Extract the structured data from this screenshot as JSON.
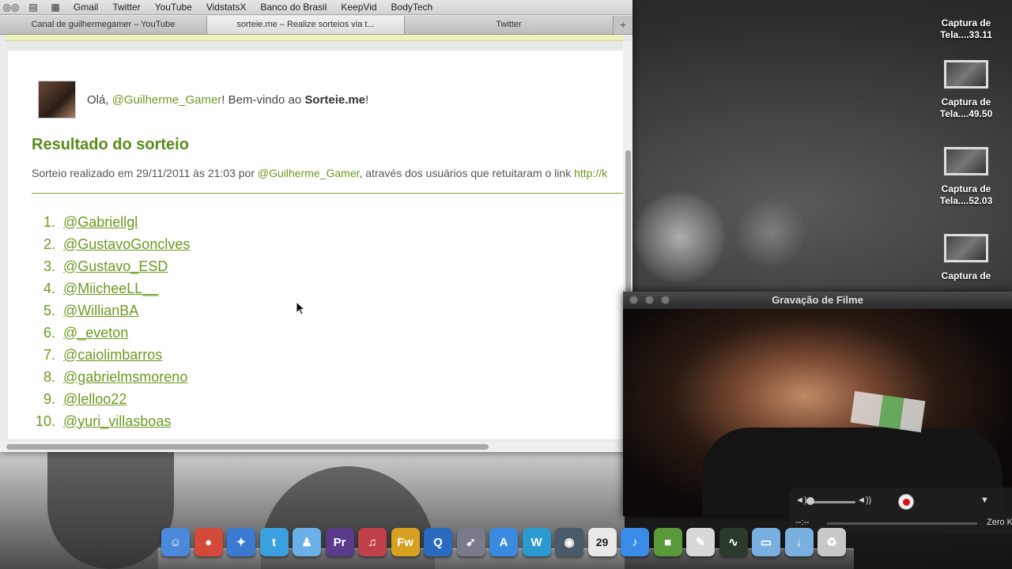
{
  "bookmarks": {
    "items": [
      "Gmail",
      "Twitter",
      "YouTube",
      "VidstatsX",
      "Banco do Brasil",
      "KeepVid",
      "BodyTech"
    ]
  },
  "tabs": [
    {
      "label": "Canal de guilhermegamer – YouTube"
    },
    {
      "label": "sorteie.me – Realize sorteios via t..."
    },
    {
      "label": "Twitter"
    }
  ],
  "tab_add_label": "+",
  "page": {
    "greeting_prefix": "Olá, ",
    "user": "@Guilherme_Gamer",
    "greeting_middle": "! Bem-vindo ao ",
    "site": "Sorteie.me",
    "greeting_suffix": "!",
    "result_title": "Resultado do sorteio",
    "info_prefix": "Sorteio realizado em 29/11/2011 às 21:03 por ",
    "info_user": "@Guilherme_Gamer",
    "info_suffix": ", através dos usuários que retuitaram o link ",
    "info_link": "http://k",
    "winners": [
      {
        "num": "1.",
        "name": "@Gabriellgl"
      },
      {
        "num": "2.",
        "name": "@GustavoGonclves"
      },
      {
        "num": "3.",
        "name": "@Gustavo_ESD"
      },
      {
        "num": "4.",
        "name": "@MiicheeLL__"
      },
      {
        "num": "5.",
        "name": "@WillianBA"
      },
      {
        "num": "6.",
        "name": "@_eveton"
      },
      {
        "num": "7.",
        "name": "@caiolimbarros"
      },
      {
        "num": "8.",
        "name": "@gabrielmsmoreno"
      },
      {
        "num": "9.",
        "name": "@lelloo22"
      },
      {
        "num": "10.",
        "name": "@yuri_villasboas"
      }
    ]
  },
  "desktop_icons": [
    {
      "line1": "Captura de",
      "line2": "Tela....33.11"
    },
    {
      "line1": "Captura de",
      "line2": "Tela....49.50"
    },
    {
      "line1": "Captura de",
      "line2": "Tela....52.03"
    },
    {
      "line1": "Captura de",
      "line2": ""
    }
  ],
  "movie": {
    "title": "Gravação de Filme",
    "time": "--:--",
    "size": "Zero K"
  },
  "dock": {
    "calendar_day": "29",
    "icons": [
      {
        "name": "finder-icon",
        "glyph": "☺",
        "color": "#4a8ad8"
      },
      {
        "name": "chrome-icon",
        "glyph": "●",
        "color": "#d44a3a"
      },
      {
        "name": "safari-icon",
        "glyph": "✦",
        "color": "#3a7ad0"
      },
      {
        "name": "twitter-icon",
        "glyph": "t",
        "color": "#3aa0e0"
      },
      {
        "name": "messenger-icon",
        "glyph": "♟",
        "color": "#6ab0e8"
      },
      {
        "name": "premiere-icon",
        "glyph": "Pr",
        "color": "#5a3a8a"
      },
      {
        "name": "soundbooth-icon",
        "glyph": "♫",
        "color": "#c0404a"
      },
      {
        "name": "fireworks-icon",
        "glyph": "Fw",
        "color": "#d8a020"
      },
      {
        "name": "quicktime-icon",
        "glyph": "Q",
        "color": "#2a6ac0"
      },
      {
        "name": "launchpad-icon",
        "glyph": "➹",
        "color": "#7a7a8a"
      },
      {
        "name": "appstore-icon",
        "glyph": "A",
        "color": "#3a8ae0"
      },
      {
        "name": "word-icon",
        "glyph": "W",
        "color": "#2a9ad0"
      },
      {
        "name": "camera-icon",
        "glyph": "◉",
        "color": "#4a5a6a"
      },
      {
        "name": "calendar-icon",
        "glyph": "29",
        "color": "#e8e8e8"
      },
      {
        "name": "itunes-icon",
        "glyph": "♪",
        "color": "#3a8ae8"
      },
      {
        "name": "minecraft-icon",
        "glyph": "■",
        "color": "#5a9a3a"
      },
      {
        "name": "preview-icon",
        "glyph": "✎",
        "color": "#d8d8d8"
      },
      {
        "name": "activity-monitor-icon",
        "glyph": "∿",
        "color": "#2a3a2a"
      },
      {
        "name": "folder-icon",
        "glyph": "▭",
        "color": "#7ab0e0"
      },
      {
        "name": "downloads-folder-icon",
        "glyph": "↓",
        "color": "#7ab0e0"
      },
      {
        "name": "trash-icon",
        "glyph": "♻",
        "color": "#c8c8c8"
      }
    ]
  }
}
